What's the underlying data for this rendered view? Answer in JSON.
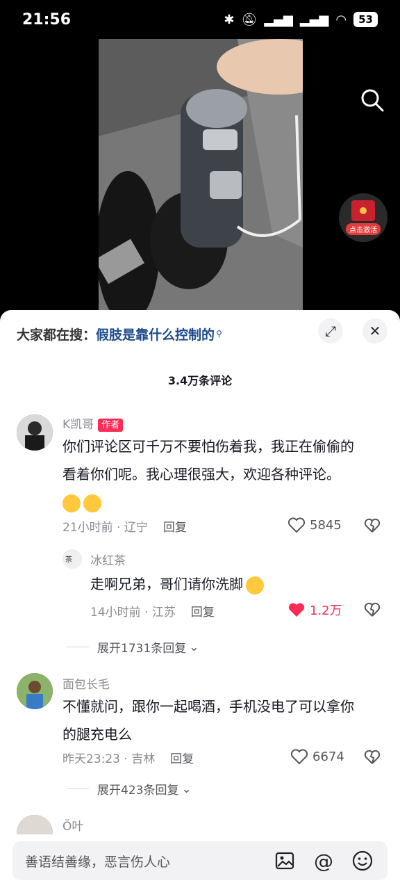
{
  "status_bar": {
    "time": "21:56",
    "battery": "53"
  },
  "video": {
    "redpack_label": "点击激活"
  },
  "sheet": {
    "hot_search_prefix": "大家都在搜：",
    "hot_search_query": "假肢是靠什么控制的",
    "comment_count": "3.4万条评论"
  },
  "comments": [
    {
      "user": "K凯哥",
      "author_tag": "作者",
      "text_line1": "你们评论区可千万不要怕伤着我，我正在偷偷的",
      "text_line2": "看着你们呢。我心理很强大，欢迎各种评论。",
      "meta": "21小时前 · 辽宁",
      "reply_label": "回复",
      "likes": "5845",
      "sub_reply": {
        "user": "冰红茶",
        "text": "走啊兄弟，哥们请你洗脚",
        "meta": "14小时前 · 江苏",
        "reply_label": "回复",
        "likes": "1.2万"
      },
      "expand_label": "展开1731条回复"
    },
    {
      "user": "面包长毛",
      "text_line1": "不懂就问，跟你一起喝酒，手机没电了可以拿你",
      "text_line2": "的腿充电么",
      "meta": "昨天23:23 · 吉林",
      "reply_label": "回复",
      "likes": "6674",
      "expand_label": "展开423条回复"
    },
    {
      "user": "Ö叶"
    }
  ],
  "input": {
    "placeholder": "善语结善缘，恶言伤人心"
  },
  "colors": {
    "like_active": "#fe2c55",
    "link": "#1c4a8c"
  }
}
